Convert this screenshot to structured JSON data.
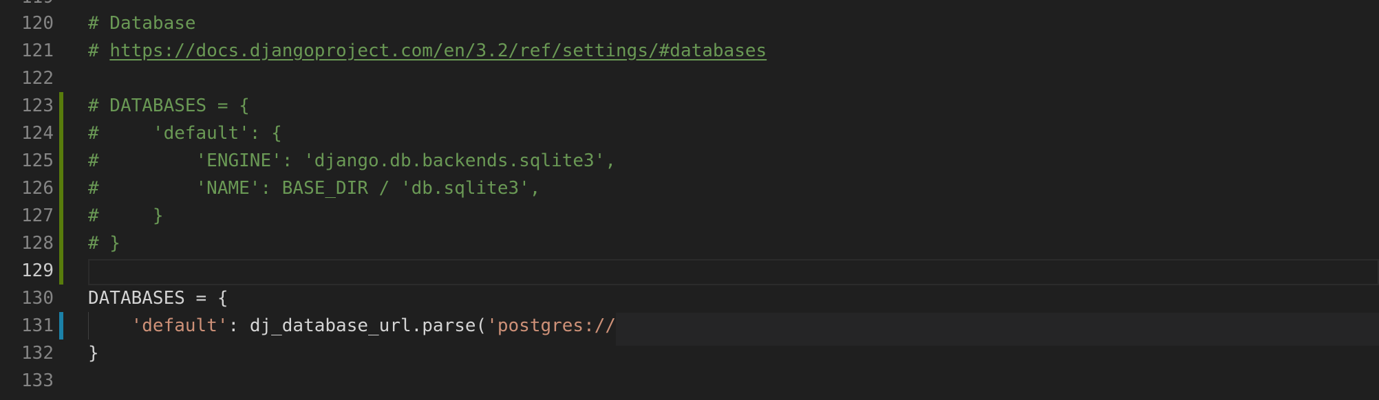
{
  "editor": {
    "top_partial_line_number": "119",
    "lines": [
      {
        "num": "120",
        "text": "# Database"
      },
      {
        "num": "121",
        "prefix": "# ",
        "link": "https://docs.djangoproject.com/en/3.2/ref/settings/#databases"
      },
      {
        "num": "122",
        "text": ""
      },
      {
        "num": "123",
        "text": "# DATABASES = {"
      },
      {
        "num": "124",
        "text": "#     'default': {"
      },
      {
        "num": "125",
        "text": "#         'ENGINE': 'django.db.backends.sqlite3',"
      },
      {
        "num": "126",
        "text": "#         'NAME': BASE_DIR / 'db.sqlite3',"
      },
      {
        "num": "127",
        "text": "#     }"
      },
      {
        "num": "128",
        "text": "# }"
      },
      {
        "num": "129",
        "text": ""
      },
      {
        "num": "130",
        "text": "DATABASES = {"
      },
      {
        "num": "131",
        "indent": "    ",
        "str1": "'default'",
        "mid": ": dj_database_url.parse(",
        "str2": "'postgres://"
      },
      {
        "num": "132",
        "text": "}"
      },
      {
        "num": "133",
        "text": ""
      }
    ]
  },
  "colors": {
    "background": "#1f1f1f",
    "comment": "#6a9955",
    "string": "#ce9178",
    "text": "#d4d4d4",
    "line_number": "#858585",
    "modified_marker": "#587c0c",
    "added_marker": "#1b81a8"
  }
}
